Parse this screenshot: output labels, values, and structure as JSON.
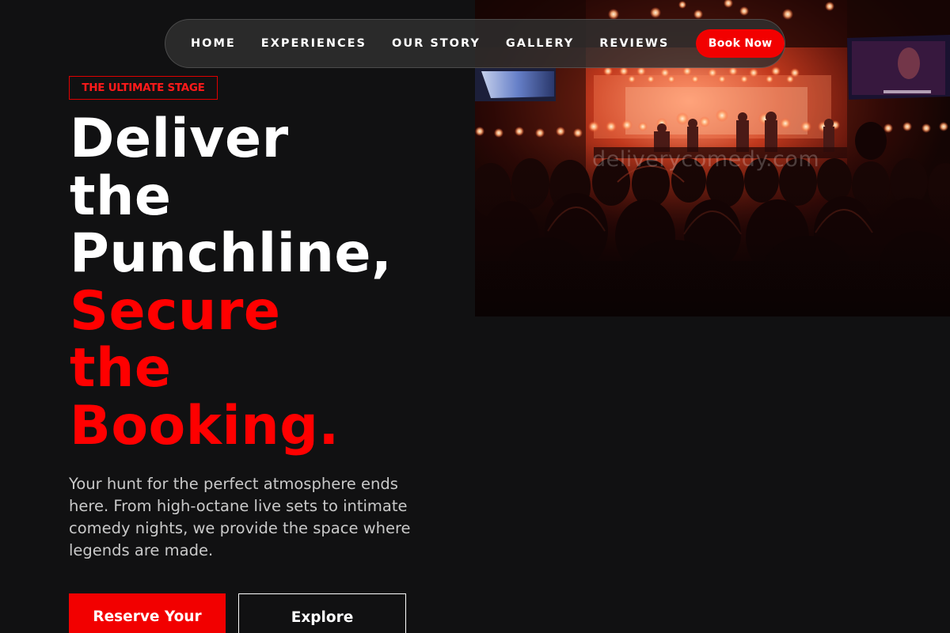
{
  "nav": {
    "items": [
      {
        "label": "HOME"
      },
      {
        "label": "EXPERIENCES"
      },
      {
        "label": "OUR STORY"
      },
      {
        "label": "GALLERY"
      },
      {
        "label": "REVIEWS"
      }
    ],
    "cta_label": "Book Now"
  },
  "hero": {
    "badge": "THE ULTIMATE STAGE",
    "headline_white": [
      "Deliver",
      "the",
      "Punchline,"
    ],
    "headline_red": [
      "Secure",
      "the",
      "Booking."
    ],
    "subtitle": "Your hunt for the perfect atmosphere ends here. From high-octane live sets to intimate comedy nights, we provide the space where legends are made.",
    "primary_button": "Reserve Your",
    "secondary_button": "Explore",
    "watermark": "deliverycomedy.com"
  },
  "colors": {
    "background": "#111112",
    "accent": "#f20000",
    "headline_red": "#ff0000",
    "text_white": "#ffffff",
    "text_muted": "#c9c9c9"
  },
  "icons": []
}
